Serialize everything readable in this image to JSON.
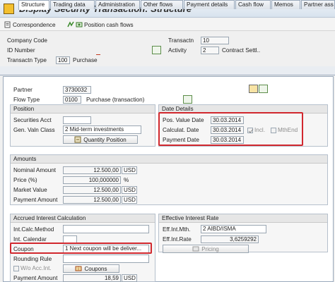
{
  "window": {
    "title": "Display Security Transaction: Structure"
  },
  "toolbar": {
    "correspondence": "Correspondence",
    "position_cash_flows": "Position cash flows"
  },
  "header": {
    "company_code_label": "Company Code",
    "id_number_label": "ID Number",
    "transactn_type_label": "Transactn Type",
    "transactn_type_value": "100",
    "transactn_type_text": "Purchase",
    "transactn_label": "Transactn",
    "transactn_value": "10",
    "activity_label": "Activity",
    "activity_value": "2",
    "activity_text": "Contract Settl.."
  },
  "tabs": [
    "Structure",
    "Trading data",
    "Administration",
    "Other flows",
    "Payment details",
    "Cash flow",
    "Memos",
    "Partner ass"
  ],
  "partner": {
    "partner_label": "Partner",
    "partner_value": "3730032",
    "flow_type_label": "Flow Type",
    "flow_type_value": "0100",
    "flow_type_text": "Purchase (transaction)"
  },
  "position": {
    "title": "Position",
    "securities_acct_label": "Securities Acct",
    "gen_valn_class_label": "Gen. Valn Class",
    "gen_valn_class_value": "2 Mid-term investments",
    "quantity_position_button": "Quantity Position"
  },
  "date_details": {
    "title": "Date Details",
    "pos_value_date_label": "Pos. Value Date",
    "pos_value_date_value": "30.03.2014",
    "calculat_date_label": "Calculat. Date",
    "calculat_date_value": "30.03.2014",
    "incl_label": "Incl.",
    "mthend_label": "MthEnd",
    "payment_date_label": "Payment Date",
    "payment_date_value": "30.03.2014"
  },
  "amounts": {
    "title": "Amounts",
    "nominal_amount_label": "Nominal Amount",
    "nominal_amount_value": "12.500,00",
    "nominal_amount_unit": "USD",
    "price_label": "Price (%)",
    "price_value": "100,000000",
    "price_unit": "%",
    "market_value_label": "Market Value",
    "market_value_value": "12.500,00",
    "market_value_unit": "USD",
    "payment_amount_label": "Payment Amount",
    "payment_amount_value": "12.500,00",
    "payment_amount_unit": "USD"
  },
  "accrued": {
    "title": "Accrued Interest Calculation",
    "int_calc_method_label": "Int.Calc.Method",
    "int_calendar_label": "Int. Calendar",
    "coupon_label": "Coupon",
    "coupon_value": "1 Next coupon will be deliver...",
    "rounding_rule_label": "Rounding Rule",
    "wo_acc_int_label": "W/o Acc.Int.",
    "coupons_button": "Coupons",
    "accrued_amount_label": "Payment Amount",
    "accrued_amount_value": "18,59",
    "accrued_amount_unit": "USD"
  },
  "effective": {
    "title": "Effective Interest Rate",
    "eff_int_mth_label": "Eff.Int.Mth.",
    "eff_int_mth_value": "2 AIBD/ISMA",
    "eff_int_rate_label": "Eff.Int.Rate",
    "eff_int_rate_value": "3,6259292",
    "pricing_button": "Pricing"
  },
  "colors": {
    "highlight": "#d1282e",
    "title_bar": "#dde6ef",
    "panel_border": "#9aa9bb"
  }
}
